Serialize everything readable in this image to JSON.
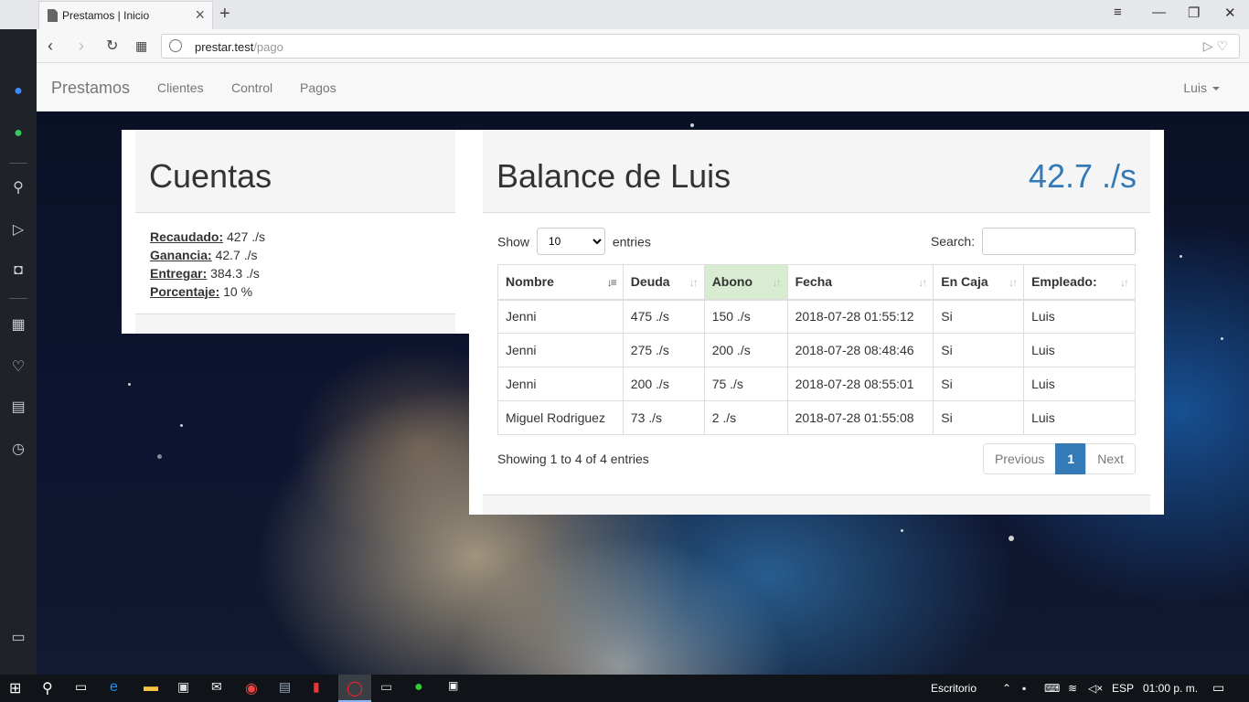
{
  "browser": {
    "tab_title": "Prestamos | Inicio",
    "url_host": "prestar.test",
    "url_path": "/pago"
  },
  "navbar": {
    "brand": "Prestamos",
    "links": [
      "Clientes",
      "Control",
      "Pagos"
    ],
    "user": "Luis"
  },
  "cuentas": {
    "title": "Cuentas",
    "stats": [
      {
        "label": "Recaudado:",
        "value": "427 ./s"
      },
      {
        "label": "Ganancia:",
        "value": "42.7 ./s"
      },
      {
        "label": "Entregar:",
        "value": "384.3 ./s"
      },
      {
        "label": "Porcentaje:",
        "value": "10 %"
      }
    ]
  },
  "balance": {
    "title": "Balance de Luis",
    "amount": "42.7 ./s",
    "show_label": "Show",
    "entries_label": "entries",
    "page_size": "10",
    "search_label": "Search:",
    "search_value": "",
    "columns": [
      "Nombre",
      "Deuda",
      "Abono",
      "Fecha",
      "En Caja",
      "Empleado:"
    ],
    "rows": [
      [
        "Jenni",
        "475 ./s",
        "150 ./s",
        "2018-07-28 01:55:12",
        "Si",
        "Luis"
      ],
      [
        "Jenni",
        "275 ./s",
        "200 ./s",
        "2018-07-28 08:48:46",
        "Si",
        "Luis"
      ],
      [
        "Jenni",
        "200 ./s",
        "75 ./s",
        "2018-07-28 08:55:01",
        "Si",
        "Luis"
      ],
      [
        "Miguel Rodriguez",
        "73 ./s",
        "2 ./s",
        "2018-07-28 01:55:08",
        "Si",
        "Luis"
      ]
    ],
    "info": "Showing 1 to 4 of 4 entries",
    "pager": {
      "previous": "Previous",
      "current": "1",
      "next": "Next"
    }
  },
  "taskbar": {
    "desktop_label": "Escritorio",
    "language": "ESP",
    "clock": "01:00 p. m."
  },
  "colors": {
    "accent": "#337ab7",
    "sorted_column": "#d7ecd0",
    "opera_red": "#ff1b2d"
  }
}
